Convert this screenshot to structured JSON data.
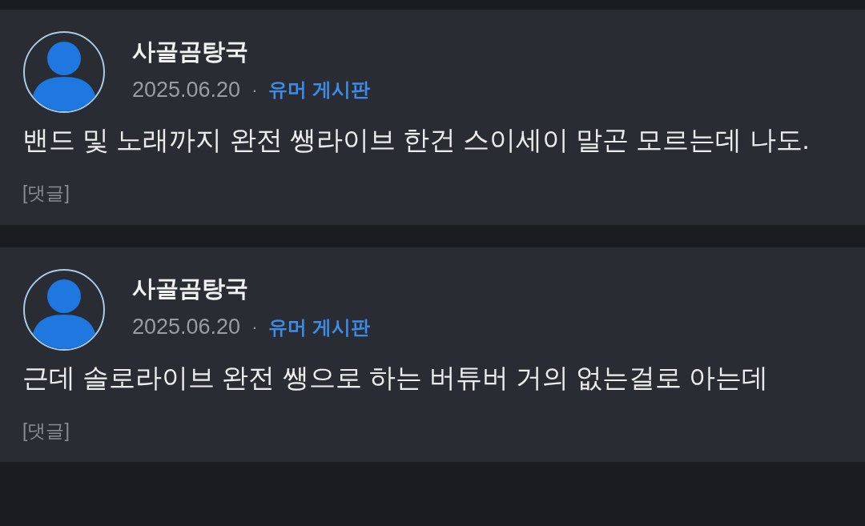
{
  "posts": [
    {
      "author": "사골곰탕국",
      "date": "2025.06.20",
      "separator": "·",
      "board": "유머 게시판",
      "body": "밴드 및 노래까지 완전 쌩라이브 한건 스이세이 말곤 모르는데 나도.",
      "tag": "[댓글]"
    },
    {
      "author": "사골곰탕국",
      "date": "2025.06.20",
      "separator": "·",
      "board": "유머 게시판",
      "body": "근데 솔로라이브 완전 쌩으로 하는 버튜버 거의 없는걸로 아는데",
      "tag": "[댓글]"
    }
  ]
}
